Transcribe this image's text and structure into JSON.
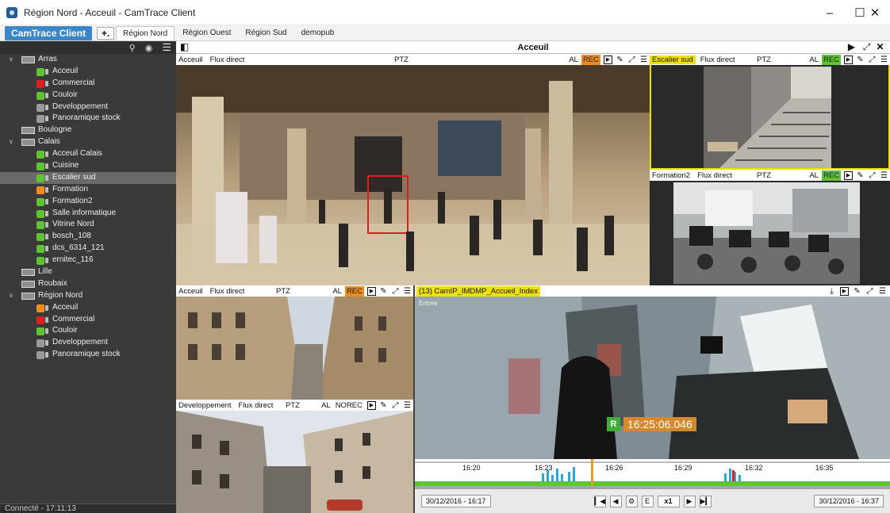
{
  "window": {
    "title": "Région Nord - Acceuil - CamTrace Client",
    "minimize": "–",
    "maximize": "☐",
    "close": "✕"
  },
  "tabs": {
    "brand": "CamTrace Client",
    "add": "+.",
    "items": [
      "Région Nord",
      "Région Ouest",
      "Région Sud",
      "demopub"
    ]
  },
  "sidebar": {
    "toolbar_icons": [
      "search-icon",
      "eye-icon",
      "menu-icon"
    ],
    "tree": [
      {
        "type": "site",
        "label": "Arras",
        "expanded": true
      },
      {
        "type": "cam",
        "label": "Acceuil",
        "color": "#5fc431"
      },
      {
        "type": "cam",
        "label": "Commercial",
        "color": "#e02020"
      },
      {
        "type": "cam",
        "label": "Couloir",
        "color": "#5fc431"
      },
      {
        "type": "cam",
        "label": "Developpement",
        "color": "#9a9a9a"
      },
      {
        "type": "cam",
        "label": "Panoramique stock",
        "color": "#9a9a9a"
      },
      {
        "type": "site",
        "label": "Boulogne",
        "expanded": false
      },
      {
        "type": "site",
        "label": "Calais",
        "expanded": true
      },
      {
        "type": "cam",
        "label": "Acceuil Calais",
        "color": "#5fc431"
      },
      {
        "type": "cam",
        "label": "Cuisine",
        "color": "#5fc431"
      },
      {
        "type": "cam",
        "label": "Escalier sud",
        "color": "#5fc431",
        "selected": true
      },
      {
        "type": "cam",
        "label": "Formation",
        "color": "#f08c1e"
      },
      {
        "type": "cam",
        "label": "Formation2",
        "color": "#5fc431"
      },
      {
        "type": "cam",
        "label": "Salle informatique",
        "color": "#5fc431"
      },
      {
        "type": "cam",
        "label": "Vitrine Nord",
        "color": "#5fc431"
      },
      {
        "type": "cam",
        "label": "bosch_108",
        "color": "#5fc431"
      },
      {
        "type": "cam",
        "label": "dcs_6314_121",
        "color": "#5fc431"
      },
      {
        "type": "cam",
        "label": "ernitec_116",
        "color": "#5fc431"
      },
      {
        "type": "site",
        "label": "Lille",
        "expanded": false
      },
      {
        "type": "site",
        "label": "Roubaix",
        "expanded": false
      },
      {
        "type": "site",
        "label": "Région Nord",
        "expanded": true
      },
      {
        "type": "cam",
        "label": "Acceuil",
        "color": "#f08c1e"
      },
      {
        "type": "cam",
        "label": "Commercial",
        "color": "#e02020"
      },
      {
        "type": "cam",
        "label": "Couloir",
        "color": "#5fc431"
      },
      {
        "type": "cam",
        "label": "Developpement",
        "color": "#9a9a9a"
      },
      {
        "type": "cam",
        "label": "Panoramique stock",
        "color": "#9a9a9a"
      }
    ],
    "status": "Connecté - 17:11:13"
  },
  "main": {
    "title": "Acceuil",
    "panels": {
      "p1": {
        "cam": "Acceuil",
        "flux": "Flux direct",
        "ptz": "PTZ",
        "al": "AL",
        "rec": "REC"
      },
      "p2": {
        "cam": "Escalier sud",
        "flux": "Flux direct",
        "ptz": "PTZ",
        "al": "AL",
        "rec": "REC"
      },
      "p3": {
        "cam": "Formation2",
        "flux": "Flux direct",
        "ptz": "PTZ",
        "al": "AL",
        "rec": "REC"
      },
      "p4": {
        "cam": "Acceuil",
        "flux": "Flux direct",
        "ptz": "PTZ",
        "al": "AL",
        "rec": "REC"
      },
      "p5": {
        "cam": "Developpement",
        "flux": "Flux direct",
        "ptz": "PTZ",
        "al": "AL",
        "rec": "NOREC"
      }
    },
    "playback": {
      "title": "(13) CamIP_IMDMP_Accueil_Index",
      "overlay_label": "Entree",
      "rec_badge": "R",
      "time": "16:25:06.046",
      "ticks": [
        "16:20",
        "16:23",
        "16:26",
        "16:29",
        "16:32",
        "16:35"
      ],
      "start": "30/12/2016 - 16:17",
      "end": "30/12/2016 - 16:37",
      "speed": "x1"
    }
  }
}
